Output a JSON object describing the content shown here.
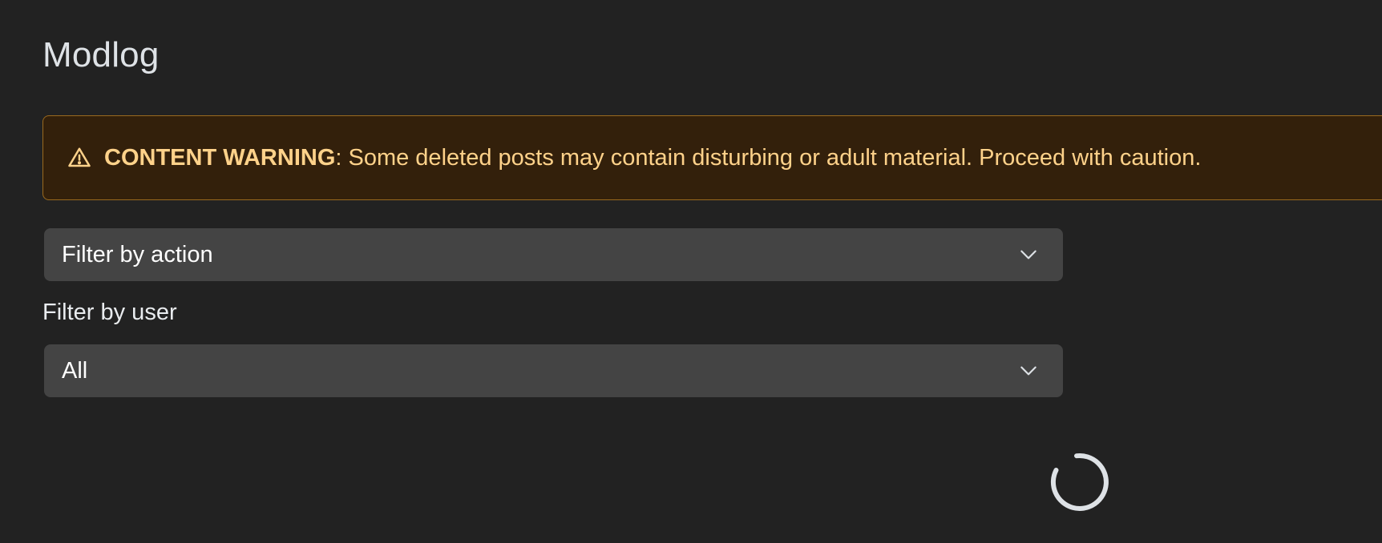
{
  "page": {
    "title": "Modlog"
  },
  "warning": {
    "icon": "warning-triangle-icon",
    "label": "CONTENT WARNING",
    "separator": ":",
    "message": " Some deleted posts may contain disturbing or adult material. Proceed with caution.",
    "colors": {
      "background": "#33200b",
      "border": "#9a6a1e",
      "text": "#ffd28a"
    }
  },
  "filters": {
    "action": {
      "selected": "Filter by action",
      "icon": "chevron-down-icon"
    },
    "user": {
      "label": "Filter by user",
      "selected": "All",
      "icon": "chevron-down-icon"
    }
  },
  "loading": {
    "icon": "loading-spinner-icon"
  }
}
